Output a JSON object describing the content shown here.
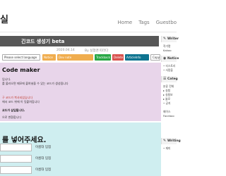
{
  "site": {
    "title": "실",
    "subtitle": ""
  },
  "nav": [
    "Home",
    "Tags",
    "Guestbo"
  ],
  "post": {
    "title": "긴코드 생성기 beta",
    "date": "2020.04.14",
    "author": "By 실험맨 따라다",
    "tag_lang": "Please select language",
    "tags": [
      "Notice",
      "Dev note",
      "Trackback",
      "Delete",
      "ArticleInfo",
      "Copy"
    ]
  },
  "pink": {
    "title": "Code maker",
    "lines": [
      "입니다.",
      "를 불러오면 메모에 붙여넣을 수 있는 코드가 생성됩니다",
      "",
      "구 코드가 복사되었습니다",
      "에서 코드 위에 이 덧붙여집니다",
      "코드가 삽입됩니다.",
      "으로 변환합니다"
    ]
  },
  "cyan": {
    "title": "를 넣어주세요.",
    "inputs": [
      {
        "value": "",
        "label": "이름대 입점"
      },
      {
        "value": "",
        "label": "이름대 입점"
      },
      {
        "value": "",
        "label": "이름대 입점"
      }
    ]
  },
  "sidebar": {
    "sections": [
      {
        "icon": "✎",
        "label": "Writer"
      },
      {
        "icon": "◉",
        "label": "Notice"
      },
      {
        "icon": "☰",
        "label": "Categ"
      },
      {
        "icon": "✎",
        "label": "Writing"
      }
    ],
    "writer_items": [
      "작가명",
      "Kakao"
    ],
    "notice_items": [
      "• 티스토리",
      "• 사람을"
    ],
    "category_items": [
      "분류 전체",
      "▸ 실험",
      "▸ 실험보",
      "▸ 블로",
      "• 공지",
      "페이스",
      "Faceboo"
    ],
    "writing_items": [
      "• 재미"
    ]
  }
}
